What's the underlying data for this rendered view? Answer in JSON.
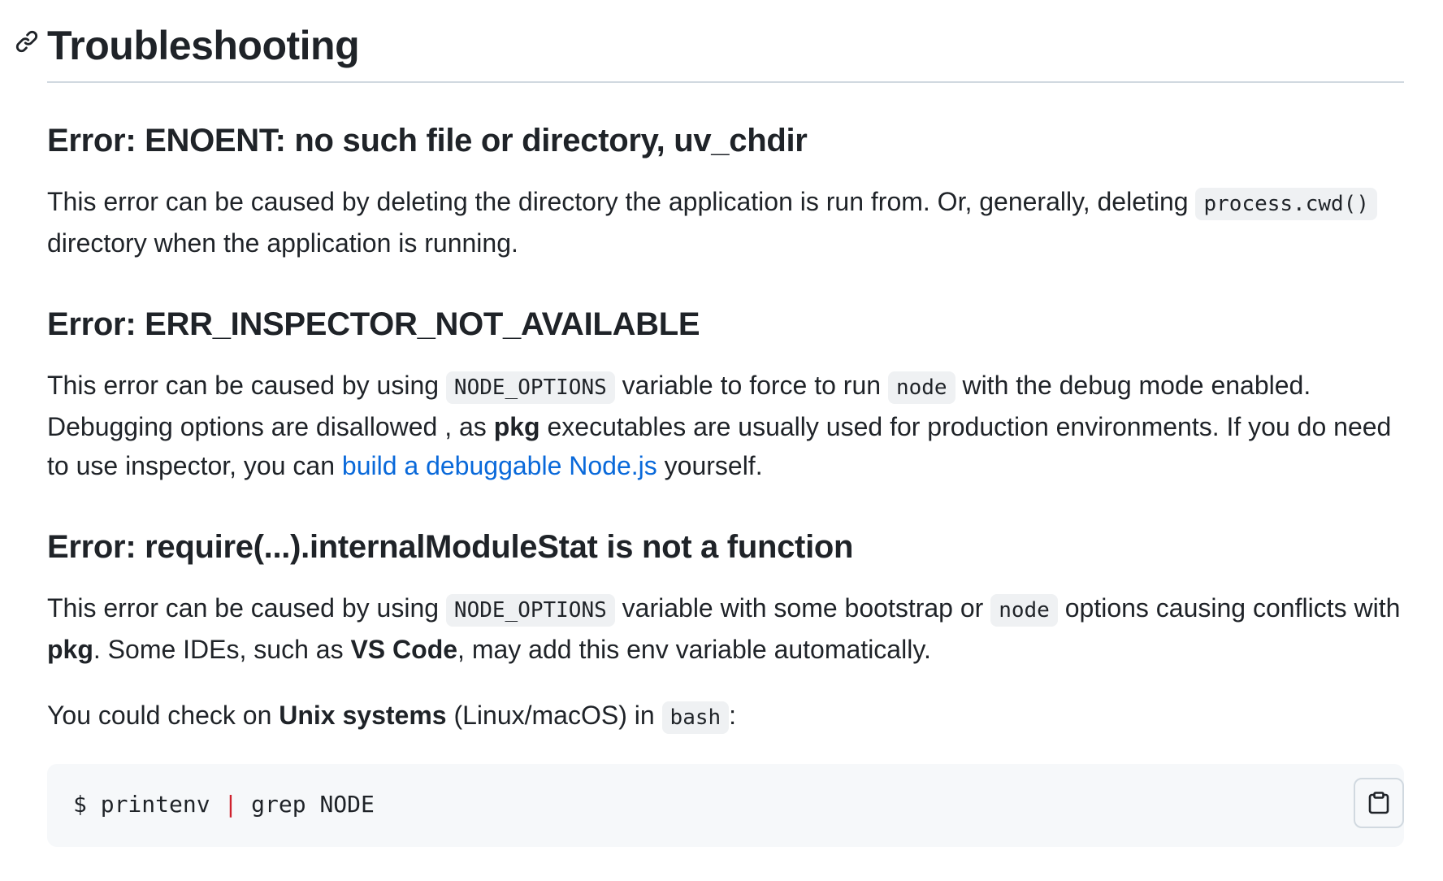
{
  "heading": {
    "title": "Troubleshooting",
    "anchor_icon": "link-icon"
  },
  "sections": [
    {
      "title": "Error: ENOENT: no such file or directory, uv_chdir",
      "paragraph": {
        "t1": "This error can be caused by deleting the directory the application is run from. Or, generally, deleting ",
        "code1": "process.cwd()",
        "t2": " directory when the application is running."
      }
    },
    {
      "title": "Error: ERR_INSPECTOR_NOT_AVAILABLE",
      "paragraph": {
        "t1": "This error can be caused by using ",
        "code1": "NODE_OPTIONS",
        "t2": " variable to force to run ",
        "code2": "node",
        "t3": " with the debug mode enabled. Debugging options are disallowed , as ",
        "bold1": "pkg",
        "t4": " executables are usually used for production environments. If you do need to use inspector, you can ",
        "link": "build a debuggable Node.js",
        "t5": " yourself."
      }
    },
    {
      "title": "Error: require(...).internalModuleStat is not a function",
      "paragraph": {
        "t1": "This error can be caused by using ",
        "code1": "NODE_OPTIONS",
        "t2": " variable with some bootstrap or ",
        "code2": "node",
        "t3": " options causing conflicts with ",
        "bold1": "pkg",
        "t4": ". Some IDEs, such as ",
        "bold2": "VS Code",
        "t5": ", may add this env variable automatically."
      },
      "paragraph2": {
        "t1": "You could check on ",
        "bold1": "Unix systems",
        "t2": " (Linux/macOS) in ",
        "code1": "bash",
        "t3": ":"
      },
      "code_block": {
        "part1": "$ printenv ",
        "pipe": "|",
        "part2": " grep NODE",
        "copy_icon": "copy-icon"
      }
    }
  ],
  "colors": {
    "text": "#1f2328",
    "link": "#0969da",
    "code_bg": "#eff1f3",
    "codeblock_bg": "#f6f8fa",
    "pipe": "#cf222e",
    "border": "#d1d9e0"
  }
}
